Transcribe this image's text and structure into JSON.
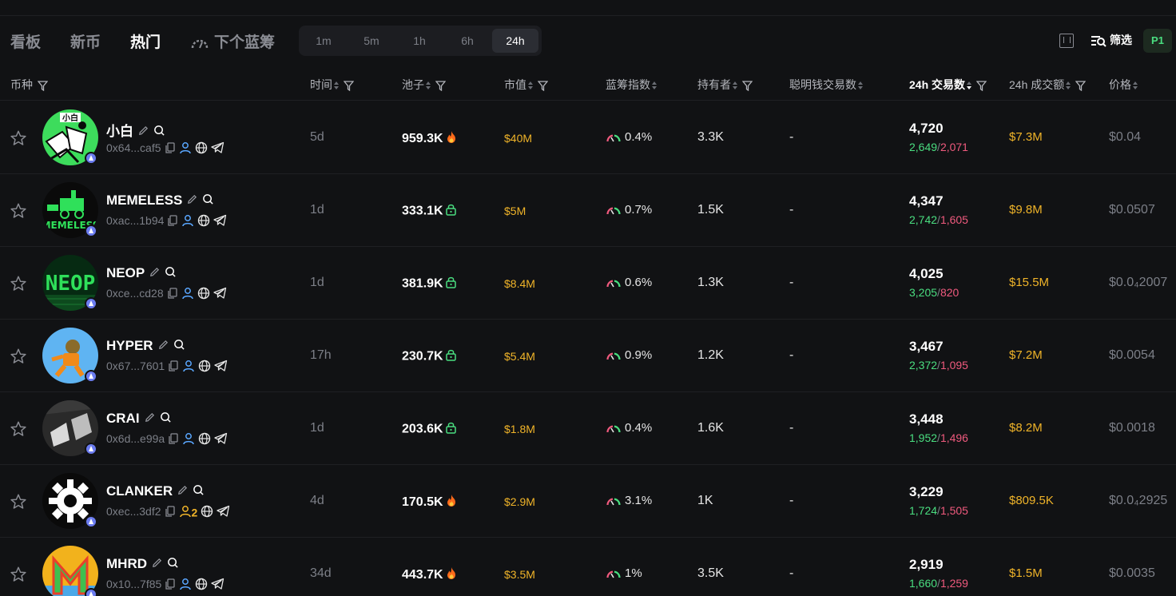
{
  "nav": {
    "tabs": [
      {
        "label": "看板",
        "active": false
      },
      {
        "label": "新币",
        "active": false
      },
      {
        "label": "热门",
        "active": true
      },
      {
        "label": "下个蓝筹",
        "active": false
      }
    ],
    "timeframes": [
      "1m",
      "5m",
      "1h",
      "6h",
      "24h"
    ],
    "active_timeframe": "24h",
    "filter_label": "筛选",
    "page_label": "P1"
  },
  "columns": {
    "token": "币种",
    "time": "时间",
    "pool": "池子",
    "mcap": "市值",
    "bluechip": "蓝筹指数",
    "holders": "持有者",
    "smart_money": "聪明钱交易数",
    "tx_24h": "24h 交易数",
    "vol_24h": "24h 成交额",
    "price": "价格"
  },
  "colors": {
    "accent_green": "#4ade80",
    "accent_red": "#f05a7e",
    "accent_gold": "#f0b429",
    "background": "#111214"
  },
  "rows": [
    {
      "name": "小白",
      "address": "0x64...caf5",
      "holders_badge": "",
      "time": "5d",
      "pool": "959.3K",
      "pool_icon": "fire-icon",
      "mcap": "$40M",
      "bluechip": "0.4%",
      "holders": "3.3K",
      "smart": "-",
      "tx_total": "4,720",
      "tx_buy": "2,649",
      "tx_sell": "2,071",
      "vol": "$7.3M",
      "price": "$0.04",
      "avatar": "xiaobai"
    },
    {
      "name": "MEMELESS",
      "address": "0xac...1b94",
      "holders_badge": "",
      "time": "1d",
      "pool": "333.1K",
      "pool_icon": "lock-icon",
      "mcap": "$5M",
      "bluechip": "0.7%",
      "holders": "1.5K",
      "smart": "-",
      "tx_total": "4,347",
      "tx_buy": "2,742",
      "tx_sell": "1,605",
      "vol": "$9.8M",
      "price": "$0.0507",
      "avatar": "memeless"
    },
    {
      "name": "NEOP",
      "address": "0xce...cd28",
      "holders_badge": "",
      "time": "1d",
      "pool": "381.9K",
      "pool_icon": "lock-icon",
      "mcap": "$8.4M",
      "bluechip": "0.6%",
      "holders": "1.3K",
      "smart": "-",
      "tx_total": "4,025",
      "tx_buy": "3,205",
      "tx_sell": "820",
      "vol": "$15.5M",
      "price": "$0.0₄2007",
      "avatar": "neop"
    },
    {
      "name": "HYPER",
      "address": "0x67...7601",
      "holders_badge": "",
      "time": "17h",
      "pool": "230.7K",
      "pool_icon": "lock-icon",
      "mcap": "$5.4M",
      "bluechip": "0.9%",
      "holders": "1.2K",
      "smart": "-",
      "tx_total": "3,467",
      "tx_buy": "2,372",
      "tx_sell": "1,095",
      "vol": "$7.2M",
      "price": "$0.0054",
      "avatar": "hyper"
    },
    {
      "name": "CRAI",
      "address": "0x6d...e99a",
      "holders_badge": "",
      "time": "1d",
      "pool": "203.6K",
      "pool_icon": "lock-icon",
      "mcap": "$1.8M",
      "bluechip": "0.4%",
      "holders": "1.6K",
      "smart": "-",
      "tx_total": "3,448",
      "tx_buy": "1,952",
      "tx_sell": "1,496",
      "vol": "$8.2M",
      "price": "$0.0018",
      "avatar": "crai"
    },
    {
      "name": "CLANKER",
      "address": "0xec...3df2",
      "holders_badge": "2",
      "time": "4d",
      "pool": "170.5K",
      "pool_icon": "fire-icon",
      "mcap": "$2.9M",
      "bluechip": "3.1%",
      "holders": "1K",
      "smart": "-",
      "tx_total": "3,229",
      "tx_buy": "1,724",
      "tx_sell": "1,505",
      "vol": "$809.5K",
      "price": "$0.0₄2925",
      "avatar": "clanker"
    },
    {
      "name": "MHRD",
      "address": "0x10...7f85",
      "holders_badge": "",
      "time": "34d",
      "pool": "443.7K",
      "pool_icon": "fire-icon",
      "mcap": "$3.5M",
      "bluechip": "1%",
      "holders": "3.5K",
      "smart": "-",
      "tx_total": "2,919",
      "tx_buy": "1,660",
      "tx_sell": "1,259",
      "vol": "$1.5M",
      "price": "$0.0035",
      "avatar": "mhrd"
    }
  ]
}
